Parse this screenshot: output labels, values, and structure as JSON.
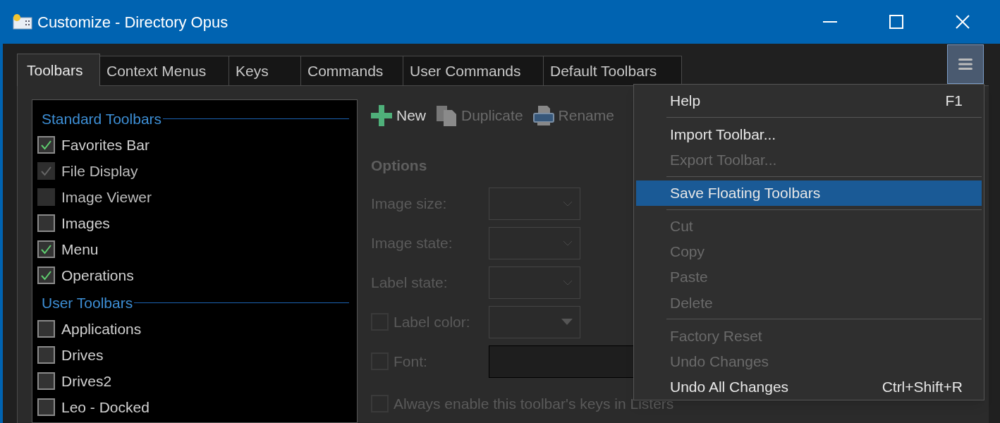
{
  "window": {
    "title": "Customize - Directory Opus"
  },
  "tabs": [
    {
      "label": "Toolbars",
      "selected": true
    },
    {
      "label": "Context Menus",
      "selected": false
    },
    {
      "label": "Keys",
      "selected": false
    },
    {
      "label": "Commands",
      "selected": false
    },
    {
      "label": "User Commands",
      "selected": false
    },
    {
      "label": "Default Toolbars",
      "selected": false
    }
  ],
  "toolbar_list": [
    {
      "heading": "Standard Toolbars",
      "items": [
        {
          "label": "Favorites Bar",
          "checked": true,
          "disabled": false
        },
        {
          "label": "File Display",
          "checked": true,
          "disabled": true
        },
        {
          "label": "Image Viewer",
          "checked": false,
          "disabled": true
        },
        {
          "label": "Images",
          "checked": false,
          "disabled": false
        },
        {
          "label": "Menu",
          "checked": true,
          "disabled": false
        },
        {
          "label": "Operations",
          "checked": true,
          "disabled": false
        }
      ]
    },
    {
      "heading": "User Toolbars",
      "items": [
        {
          "label": "Applications",
          "checked": false,
          "disabled": false
        },
        {
          "label": "Drives",
          "checked": false,
          "disabled": false
        },
        {
          "label": "Drives2",
          "checked": false,
          "disabled": false
        },
        {
          "label": "Leo - Docked",
          "checked": false,
          "disabled": false
        }
      ]
    }
  ],
  "actions": [
    {
      "kind": "new",
      "label": "New",
      "disabled": false
    },
    {
      "kind": "duplicate",
      "label": "Duplicate",
      "disabled": true
    },
    {
      "kind": "rename",
      "label": "Rename",
      "disabled": true
    }
  ],
  "options": {
    "heading": "Options",
    "rows": [
      {
        "kind": "dropdown",
        "label": "Image size:"
      },
      {
        "kind": "dropdown",
        "label": "Image state:"
      },
      {
        "kind": "dropdown",
        "label": "Label state:"
      },
      {
        "kind": "color",
        "label": "Label color:",
        "checked": false
      },
      {
        "kind": "font",
        "label": "Font:",
        "checked": false
      },
      {
        "kind": "checkbox",
        "label": "Always enable this toolbar's keys in Listers",
        "checked": false
      }
    ]
  },
  "menu": [
    {
      "kind": "item",
      "label": "Help",
      "shortcut": "F1",
      "disabled": false,
      "selected": false
    },
    {
      "kind": "separator"
    },
    {
      "kind": "item",
      "label": "Import Toolbar...",
      "disabled": false,
      "selected": false
    },
    {
      "kind": "item",
      "label": "Export Toolbar...",
      "disabled": true,
      "selected": false
    },
    {
      "kind": "separator"
    },
    {
      "kind": "item",
      "label": "Save Floating Toolbars",
      "disabled": false,
      "selected": true
    },
    {
      "kind": "separator"
    },
    {
      "kind": "item",
      "label": "Cut",
      "disabled": true,
      "selected": false
    },
    {
      "kind": "item",
      "label": "Copy",
      "disabled": true,
      "selected": false
    },
    {
      "kind": "item",
      "label": "Paste",
      "disabled": true,
      "selected": false
    },
    {
      "kind": "item",
      "label": "Delete",
      "disabled": true,
      "selected": false
    },
    {
      "kind": "separator"
    },
    {
      "kind": "item",
      "label": "Factory Reset",
      "disabled": true,
      "selected": false
    },
    {
      "kind": "item",
      "label": "Undo Changes",
      "disabled": true,
      "selected": false
    },
    {
      "kind": "item",
      "label": "Undo All Changes",
      "shortcut": "Ctrl+Shift+R",
      "disabled": false,
      "selected": false
    }
  ]
}
